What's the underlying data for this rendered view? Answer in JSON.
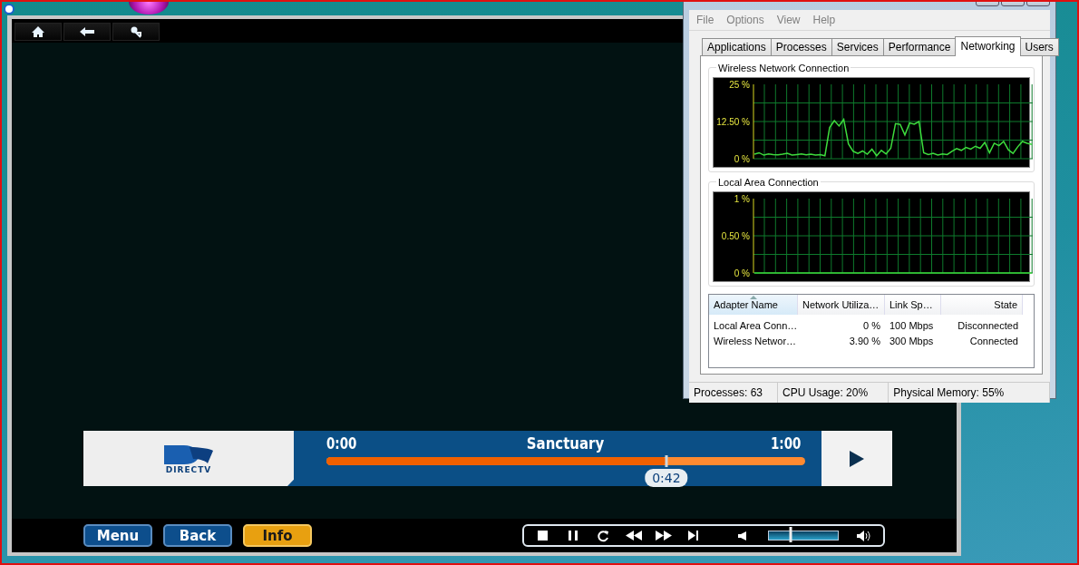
{
  "media_player": {
    "now_playing": {
      "logo_text": "DIRECTV",
      "start_time": "0:00",
      "title": "Sanctuary",
      "end_time": "1:00",
      "level": 0.71,
      "position": "0:42"
    },
    "nav_buttons": [
      {
        "label": "Menu",
        "selected": false
      },
      {
        "label": "Back",
        "selected": false
      },
      {
        "label": "Info",
        "selected": true
      }
    ],
    "volume": {
      "level": 0.32
    }
  },
  "task_manager": {
    "menu": [
      "File",
      "Options",
      "View",
      "Help"
    ],
    "tabs": [
      {
        "label": "Applications",
        "selected": false
      },
      {
        "label": "Processes",
        "selected": false
      },
      {
        "label": "Services",
        "selected": false
      },
      {
        "label": "Performance",
        "selected": false
      },
      {
        "label": "Networking",
        "selected": true
      },
      {
        "label": "Users",
        "selected": false
      }
    ],
    "graphs": [
      {
        "title": "Wireless Network Connection",
        "chart_data": {
          "type": "line",
          "grid": true,
          "ylim": [
            0,
            25
          ],
          "yticks": [
            {
              "value": 25,
              "label": "25 %"
            },
            {
              "value": 12.5,
              "label": "12.50 %"
            },
            {
              "value": 0,
              "label": "0 %"
            }
          ],
          "series": [
            {
              "color": "#3ddc3d",
              "values": [
                1.5,
                2,
                1.2,
                1.6,
                1.4,
                1.3,
                1.5,
                1.8,
                1.2,
                1.4,
                1.6,
                1.3,
                1.5,
                1.2,
                1.4,
                1.0,
                10.5,
                12.8,
                11,
                13.2,
                5,
                2.5,
                1.8,
                2.6,
                1.5,
                3.2,
                1.0,
                2.8,
                1.6,
                3.5,
                11.8,
                11.5,
                8,
                12,
                11.6,
                12.5,
                2.0,
                1.4,
                1.8,
                1.2,
                1.6,
                1.4,
                2.5,
                3.4,
                2.8,
                3.8,
                3.2,
                4.2,
                3.5,
                5.5,
                2.0,
                5.2,
                4.4,
                5.8,
                3.0,
                1.8,
                4.0,
                5.8,
                5.2,
                4.8
              ]
            }
          ]
        }
      },
      {
        "title": "Local Area Connection",
        "chart_data": {
          "type": "line",
          "grid": true,
          "ylim": [
            0,
            1
          ],
          "yticks": [
            {
              "value": 1,
              "label": "1 %"
            },
            {
              "value": 0.5,
              "label": "0.50 %"
            },
            {
              "value": 0,
              "label": "0 %"
            }
          ],
          "series": [
            {
              "color": "#3ddc3d",
              "values": [
                0,
                0,
                0,
                0,
                0,
                0,
                0,
                0,
                0,
                0,
                0,
                0,
                0,
                0,
                0,
                0,
                0,
                0,
                0,
                0,
                0,
                0,
                0,
                0,
                0,
                0,
                0,
                0,
                0,
                0
              ]
            }
          ]
        }
      }
    ],
    "table": {
      "columns": [
        "Adapter Name",
        "Network Utiliza…",
        "Link Sp…",
        "State"
      ],
      "rows": [
        [
          "Local Area Conn…",
          "0 %",
          "100 Mbps",
          "Disconnected"
        ],
        [
          "Wireless Networ…",
          "3.90 %",
          "300 Mbps",
          "Connected"
        ]
      ]
    },
    "status_bar": [
      "Processes: 63",
      "CPU Usage: 20%",
      "Physical Memory: 55%"
    ]
  }
}
